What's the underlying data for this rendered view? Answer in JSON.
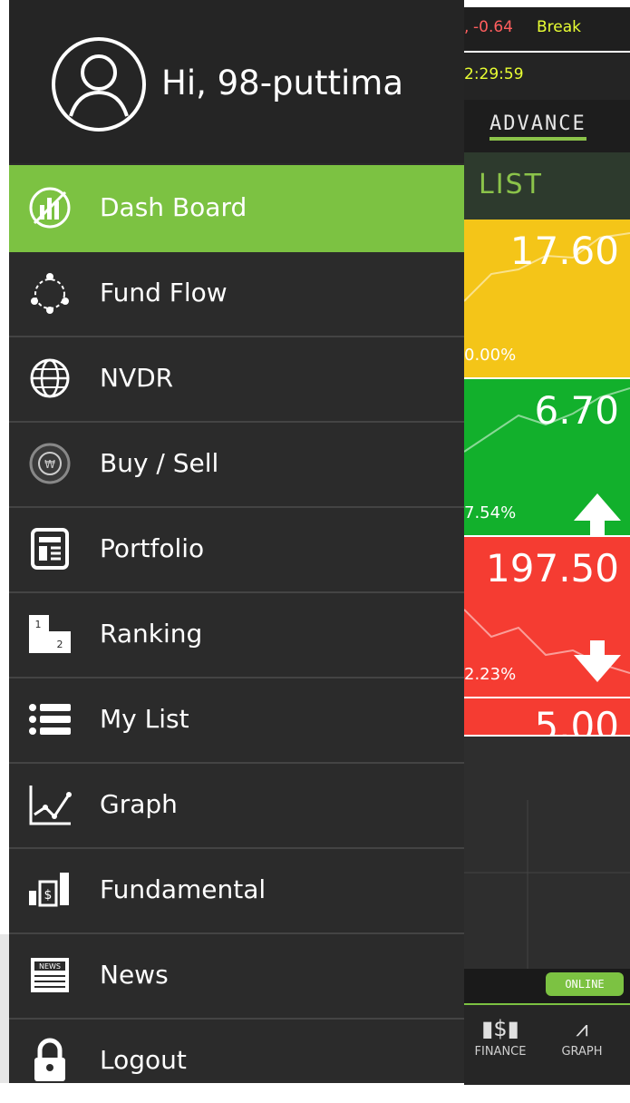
{
  "header": {
    "greeting": "Hi, 98-puttima"
  },
  "menu": {
    "items": [
      {
        "label": "Dash Board",
        "icon": "dashboard-icon",
        "active": true
      },
      {
        "label": "Fund Flow",
        "icon": "fund-flow-icon"
      },
      {
        "label": "NVDR",
        "icon": "globe-icon"
      },
      {
        "label": "Buy / Sell",
        "icon": "buy-sell-icon"
      },
      {
        "label": "Portfolio",
        "icon": "portfolio-icon"
      },
      {
        "label": "Ranking",
        "icon": "ranking-icon"
      },
      {
        "label": "My List",
        "icon": "list-icon"
      },
      {
        "label": "Graph",
        "icon": "graph-icon"
      },
      {
        "label": "Fundamental",
        "icon": "fundamental-icon"
      },
      {
        "label": "News",
        "icon": "news-icon"
      },
      {
        "label": "Logout",
        "icon": "lock-icon"
      }
    ]
  },
  "background": {
    "ticker": {
      "prefix": ",",
      "value": "-0.64",
      "word": "Break"
    },
    "clock": "2:29:59",
    "tab": "ADVANCE",
    "section": "LIST",
    "cards": [
      {
        "price": "17.60",
        "pct": "0.00%",
        "color": "#f4c518",
        "direction": "none"
      },
      {
        "price": "6.70",
        "pct": "7.54%",
        "color": "#12b02c",
        "direction": "up"
      },
      {
        "price": "197.50",
        "pct": "2.23%",
        "color": "#f53c32",
        "direction": "down"
      },
      {
        "price": "5.00",
        "pct": "",
        "color": "#f53c32",
        "direction": "none"
      }
    ],
    "status": "ONLINE",
    "nav": {
      "finance": "FINANCE",
      "graph": "GRAPH"
    }
  },
  "colors": {
    "accent": "#7cc242",
    "drawer": "#2b2b2b",
    "ticker_text": "#e9ff33"
  }
}
